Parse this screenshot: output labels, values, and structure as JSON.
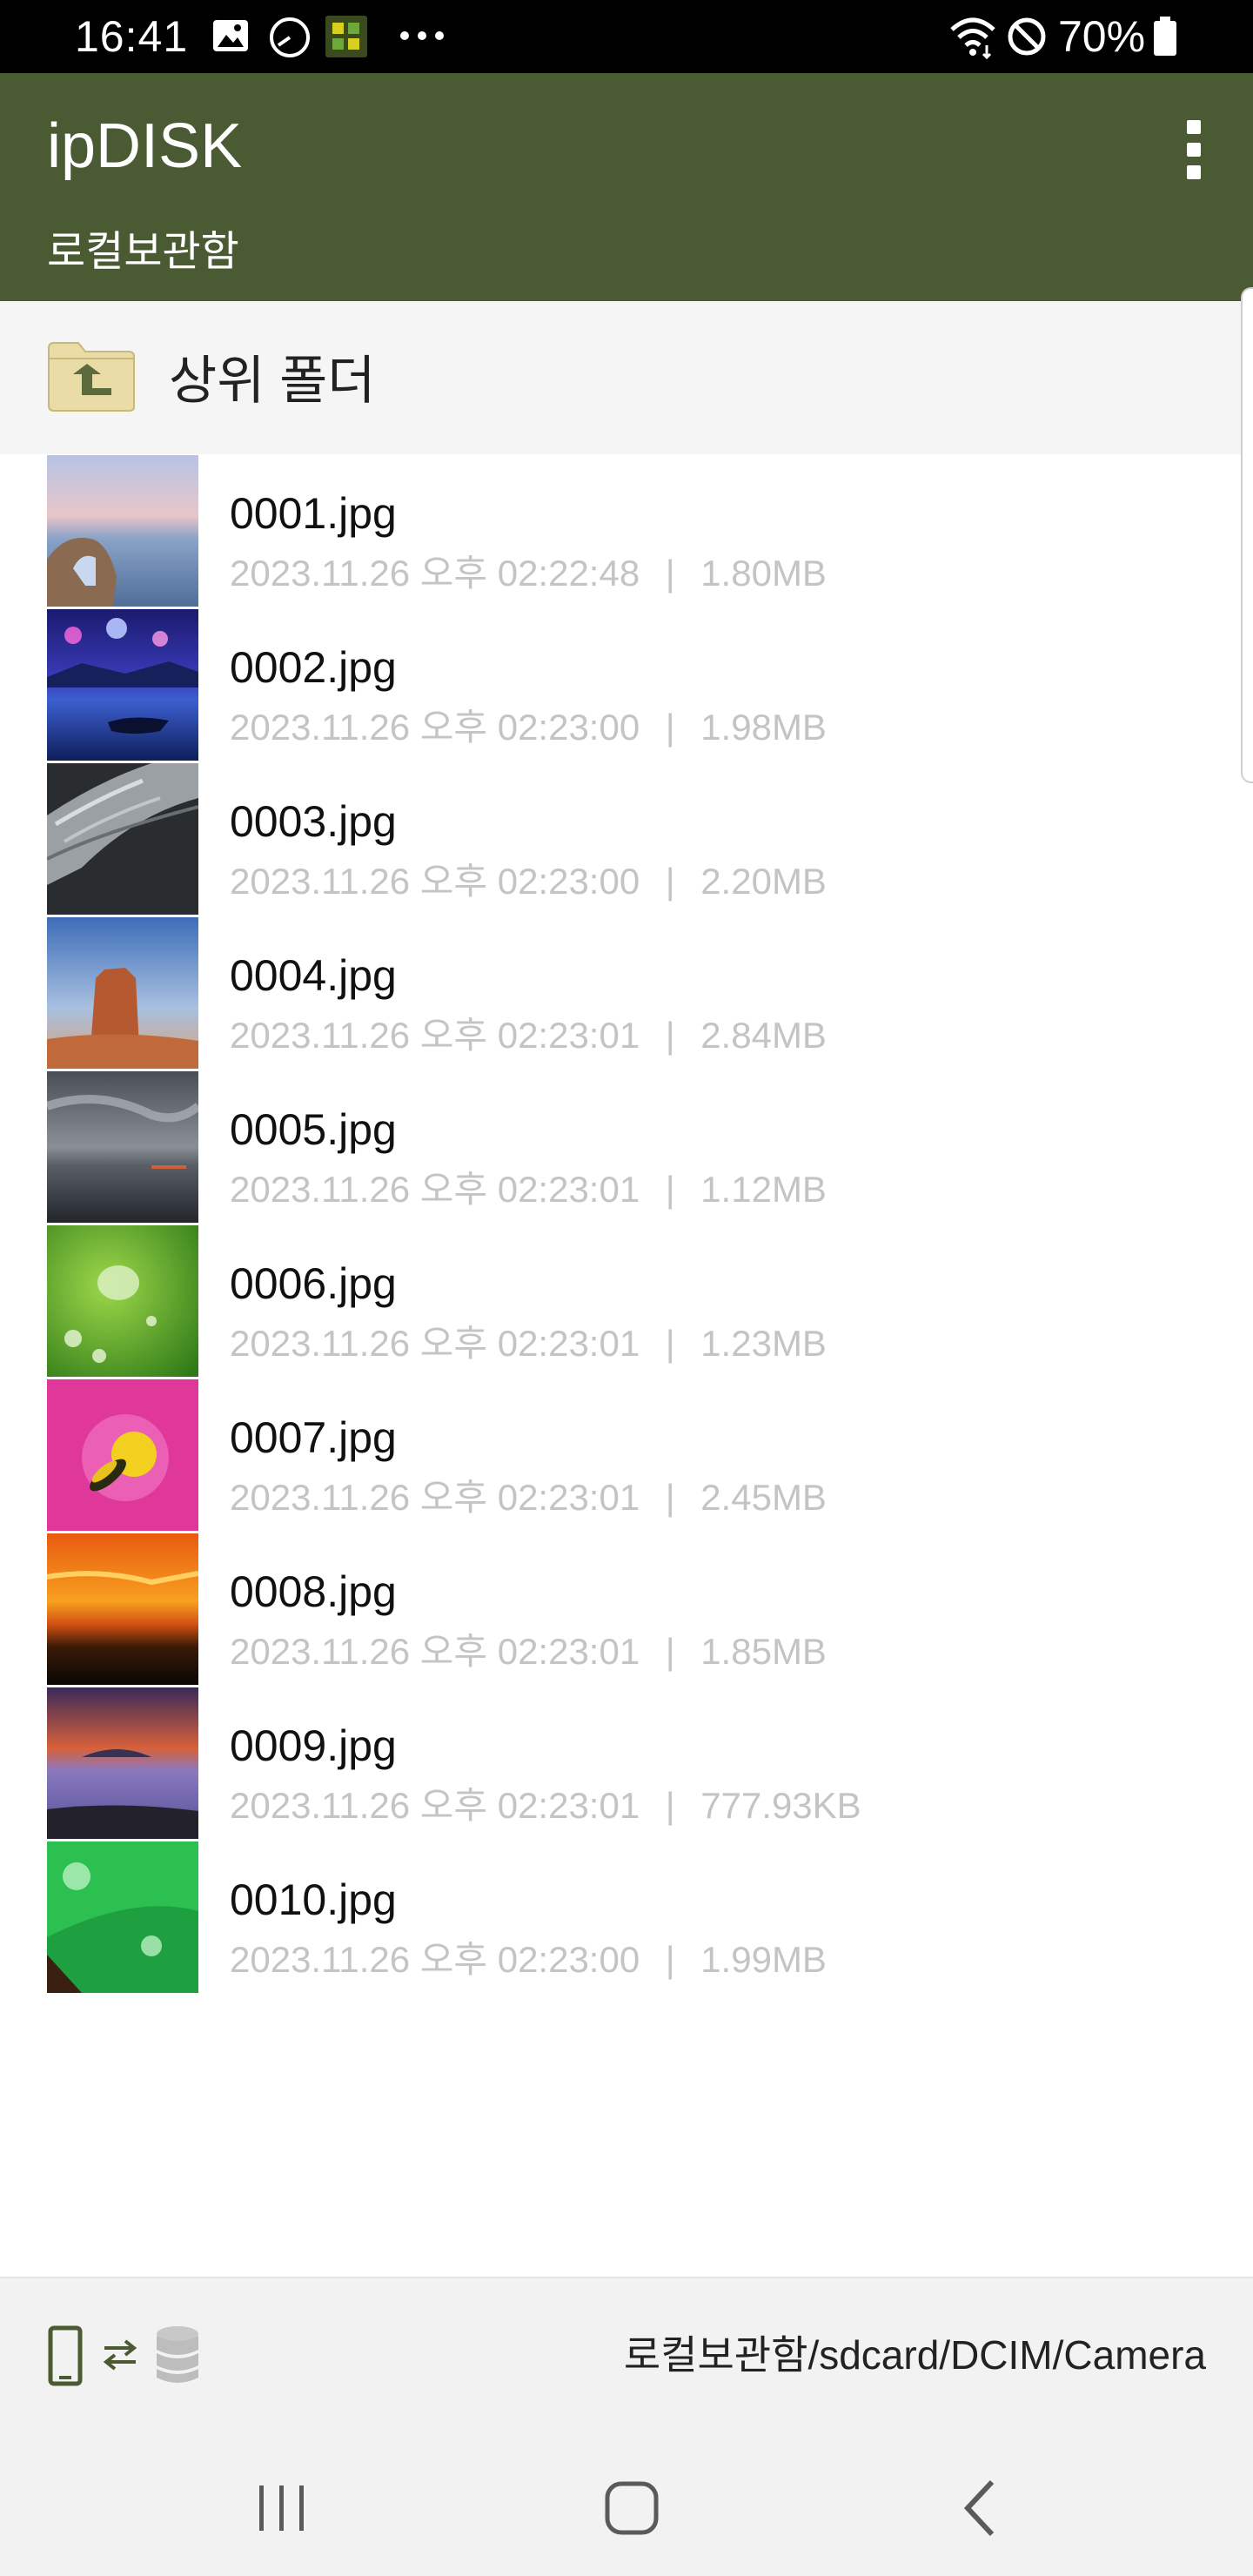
{
  "status_bar": {
    "time": "16:41",
    "battery": "70%",
    "icons": [
      "gallery-icon",
      "clock-icon",
      "app-notification-icon",
      "more-dots-icon",
      "wifi-icon",
      "do-not-disturb-icon",
      "battery-icon"
    ]
  },
  "app_bar": {
    "title": "ipDISK",
    "subtitle": "로컬보관함",
    "menu_icon": "more-vert-icon",
    "color": "#4a5b33"
  },
  "parent_folder": {
    "label": "상위 폴더",
    "icon": "folder-up-icon"
  },
  "files": [
    {
      "name": "0001.jpg",
      "date": "2023.11.26 오후 02:22:48",
      "size": "1.80MB"
    },
    {
      "name": "0002.jpg",
      "date": "2023.11.26 오후 02:23:00",
      "size": "1.98MB"
    },
    {
      "name": "0003.jpg",
      "date": "2023.11.26 오후 02:23:00",
      "size": "2.20MB"
    },
    {
      "name": "0004.jpg",
      "date": "2023.11.26 오후 02:23:01",
      "size": "2.84MB"
    },
    {
      "name": "0005.jpg",
      "date": "2023.11.26 오후 02:23:01",
      "size": "1.12MB"
    },
    {
      "name": "0006.jpg",
      "date": "2023.11.26 오후 02:23:01",
      "size": "1.23MB"
    },
    {
      "name": "0007.jpg",
      "date": "2023.11.26 오후 02:23:01",
      "size": "2.45MB"
    },
    {
      "name": "0008.jpg",
      "date": "2023.11.26 오후 02:23:01",
      "size": "1.85MB"
    },
    {
      "name": "0009.jpg",
      "date": "2023.11.26 오후 02:23:01",
      "size": "777.93KB"
    },
    {
      "name": "0010.jpg",
      "date": "2023.11.26 오후 02:23:00",
      "size": "1.99MB"
    }
  ],
  "path_bar": {
    "path": "로컬보관함/sdcard/DCIM/Camera",
    "icons": [
      "phone-icon",
      "transfer-arrows-icon",
      "disk-icon"
    ]
  },
  "nav_bar": {
    "icons": [
      "recent-apps-icon",
      "home-icon",
      "back-icon"
    ]
  }
}
